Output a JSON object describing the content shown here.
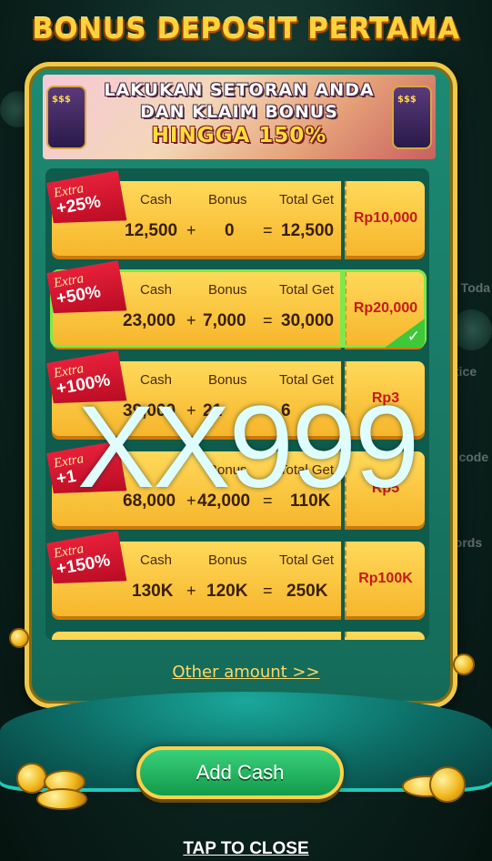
{
  "title": "BONUS DEPOSIT PERTAMA",
  "banner": {
    "line1": "LAKUKAN SETORAN ANDA",
    "line2": "DAN KLAIM BONUS",
    "line3": "HINGGA 150%"
  },
  "background_hints": [
    "s Toda",
    "tice",
    "o code",
    "cords"
  ],
  "columns": {
    "cash": "Cash",
    "bonus": "Bonus",
    "total": "Total Get"
  },
  "operators": {
    "plus": "+",
    "equals": "="
  },
  "offers": [
    {
      "extra_label": "Extra",
      "extra_pct": "+25%",
      "cash": "12,500",
      "bonus": "0",
      "total": "12,500",
      "price": "Rp10,000",
      "selected": false
    },
    {
      "extra_label": "Extra",
      "extra_pct": "+50%",
      "cash": "23,000",
      "bonus": "7,000",
      "total": "30,000",
      "price": "Rp20,000",
      "selected": true
    },
    {
      "extra_label": "Extra",
      "extra_pct": "+100%",
      "cash": "39,000",
      "bonus": "21",
      "total": "6",
      "price": "Rp3",
      "selected": false
    },
    {
      "extra_label": "Extra",
      "extra_pct": "+1",
      "cash": "68,000",
      "bonus": "42,000",
      "total": "110K",
      "price": "Rp5",
      "selected": false
    },
    {
      "extra_label": "Extra",
      "extra_pct": "+150%",
      "cash": "130K",
      "bonus": "120K",
      "total": "250K",
      "price": "Rp100K",
      "selected": false
    }
  ],
  "other_amount": "Other amount >>",
  "add_cash": "Add Cash",
  "tap_to_close": "TAP TO CLOSE",
  "watermark": "XX999",
  "colors": {
    "accent_gold": "#ffd23a",
    "panel_green": "#1d8a74",
    "price_red": "#c81818",
    "selected_green": "#7fe84a"
  }
}
